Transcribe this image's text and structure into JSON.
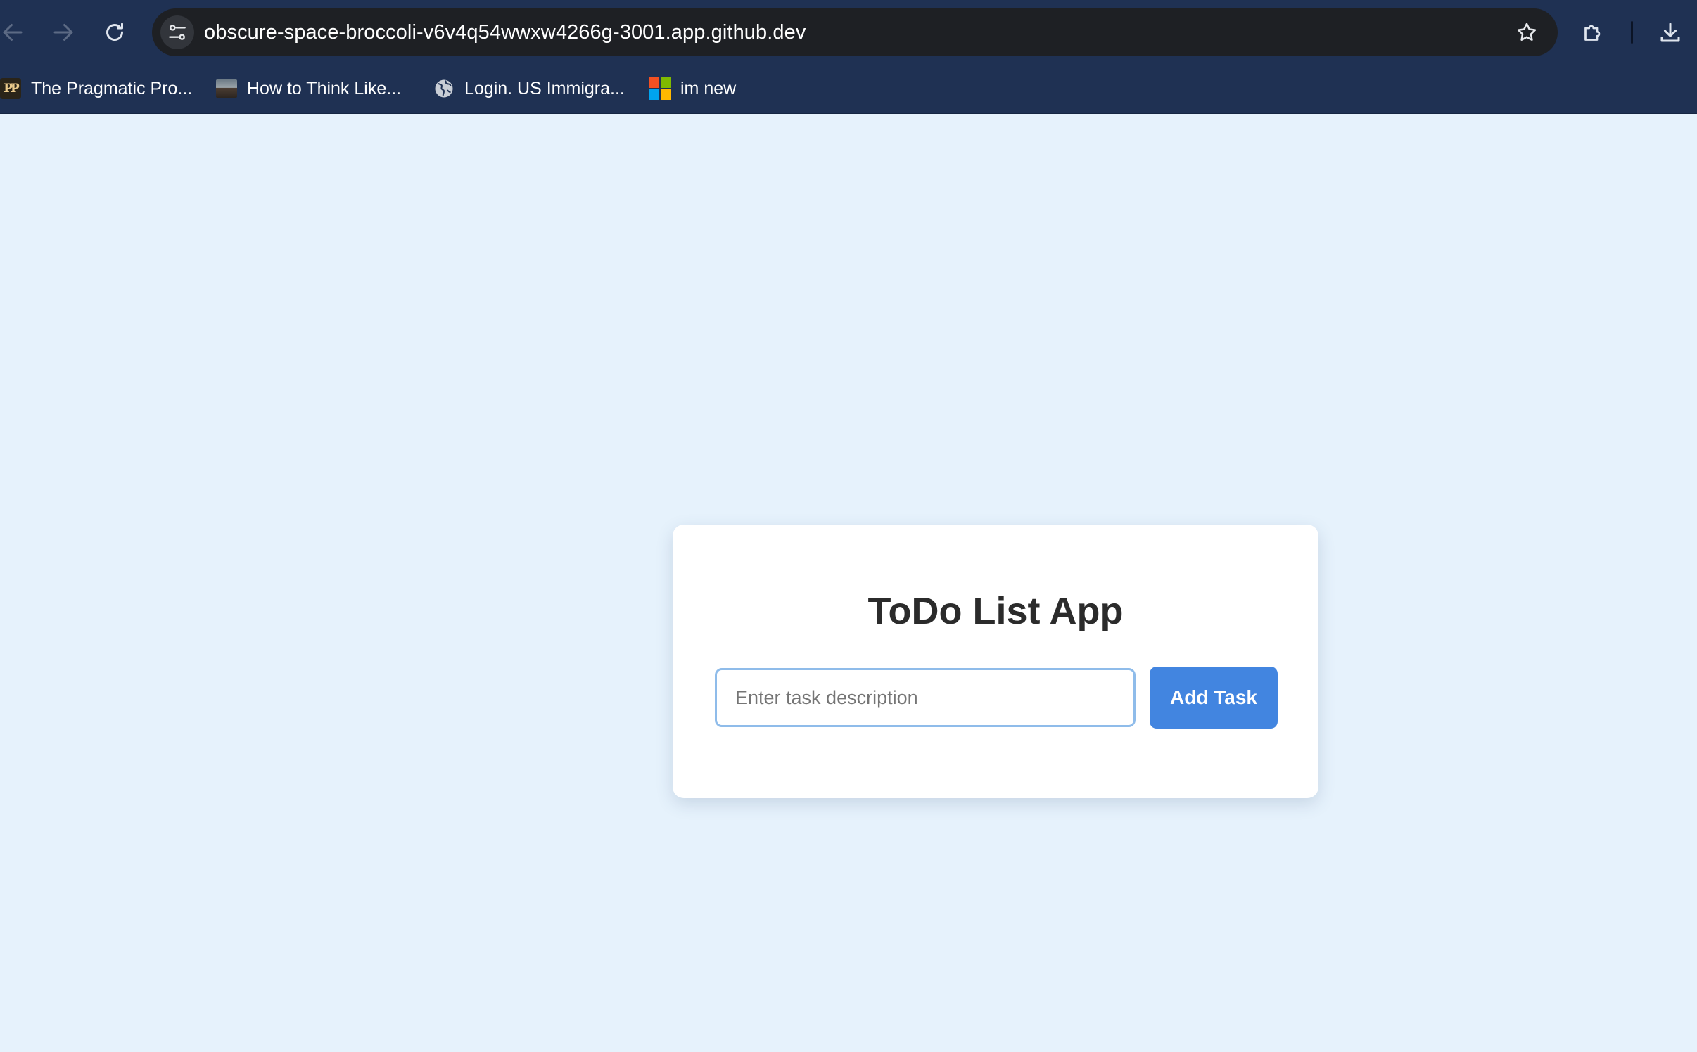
{
  "browser": {
    "url": "obscure-space-broccoli-v6v4q54wwxw4266g-3001.app.github.dev",
    "icons": {
      "back": "arrow-left-icon",
      "forward": "arrow-right-icon",
      "reload": "reload-icon",
      "site_info": "tune-icon",
      "bookmark_star": "star-icon",
      "extensions": "puzzle-icon",
      "downloads": "download-icon"
    },
    "colors": {
      "toolbar": "#1f3153",
      "omnibox": "#1e2024"
    }
  },
  "bookmarks": [
    {
      "label": "The Pragmatic Pro...",
      "icon": "pragmatic-programmer-favicon"
    },
    {
      "label": "How to Think Like...",
      "icon": "photo-thumbnail-favicon"
    },
    {
      "label": "Login. US Immigra...",
      "icon": "globe-icon"
    },
    {
      "label": "im new",
      "icon": "microsoft-logo-icon"
    }
  ],
  "app": {
    "title": "ToDo List App",
    "input": {
      "placeholder": "Enter task description",
      "value": ""
    },
    "add_button_label": "Add Task",
    "colors": {
      "page_background": "#e6f2fc",
      "card_background": "#ffffff",
      "accent": "#4285e0",
      "input_border": "#8fbcea",
      "title_text": "#2b2b2b"
    }
  }
}
